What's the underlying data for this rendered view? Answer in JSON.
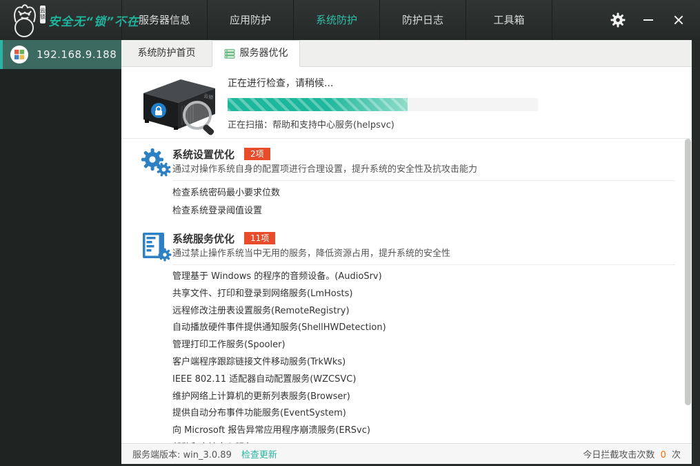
{
  "brand": {
    "slogan": "安全无“锁”不在",
    "seal_text": "云锁"
  },
  "header": {
    "nav": [
      {
        "label": "服务器信息",
        "active": false
      },
      {
        "label": "应用防护",
        "active": false
      },
      {
        "label": "系统防护",
        "active": true
      },
      {
        "label": "防护日志",
        "active": false
      },
      {
        "label": "工具箱",
        "active": false
      }
    ]
  },
  "icons": {
    "settings": "gear-icon",
    "minimize": "horizontal-bar",
    "close": "x-cross",
    "sidebar_server": "windows-color-circle",
    "tab_active": "green-server",
    "scan_art": "black-server-with-magnifier",
    "section_settings": "blue-double-gears",
    "section_services": "blue-document-with-gear"
  },
  "sidebar": {
    "server_ip": "192.168.9.188"
  },
  "tabs": [
    {
      "label": "系统防护首页",
      "active": false
    },
    {
      "label": "服务器优化",
      "active": true
    }
  ],
  "scan": {
    "status": "正在进行检查，请稍候...",
    "progress_percent": 58,
    "current": "正在扫描：帮助和支持中心服务(helpsvc)"
  },
  "sections": [
    {
      "title": "系统设置优化",
      "badge": "2项",
      "desc": "通过对操作系统自身的配置项进行合理设置，提升系统的安全性及抗攻击能力",
      "items": [
        "检查系统密码最小要求位数",
        "检查系统登录阈值设置"
      ]
    },
    {
      "title": "系统服务优化",
      "badge": "11项",
      "desc": "通过禁止操作系统当中无用的服务，降低资源占用，提升系统的安全性",
      "items": [
        "管理基于 Windows 的程序的音频设备。(AudioSrv)",
        "共享文件、打印和登录到网络服务(LmHosts)",
        "远程修改注册表设置服务(RemoteRegistry)",
        "自动播放硬件事件提供通知服务(ShellHWDetection)",
        "管理打印工作服务(Spooler)",
        "客户端程序跟踪链接文件移动服务(TrkWks)",
        "IEEE 802.11 适配器自动配置服务(WZCSVC)",
        "维护网络上计算机的更新列表服务(Browser)",
        "提供自动分布事件功能服务(EventSystem)",
        "向 Microsoft 报告异常应用程序崩溃服务(ERSvc)",
        "帮助和支持中心服务(helpsvc)"
      ]
    }
  ],
  "footer": {
    "version_label": "服务端版本: win_3.0.89",
    "update_link": "检查更新",
    "right_prefix": "今日拦截攻击次数",
    "attack_count": "0",
    "right_suffix": "次"
  },
  "colors": {
    "accent_teal": "#2bb5a2",
    "nav_active": "#2fbfa7",
    "badge_red": "#e84c2b",
    "icon_blue": "#2e80c4",
    "progress_teal": "#23bca0",
    "count_orange": "#ff6a00"
  }
}
